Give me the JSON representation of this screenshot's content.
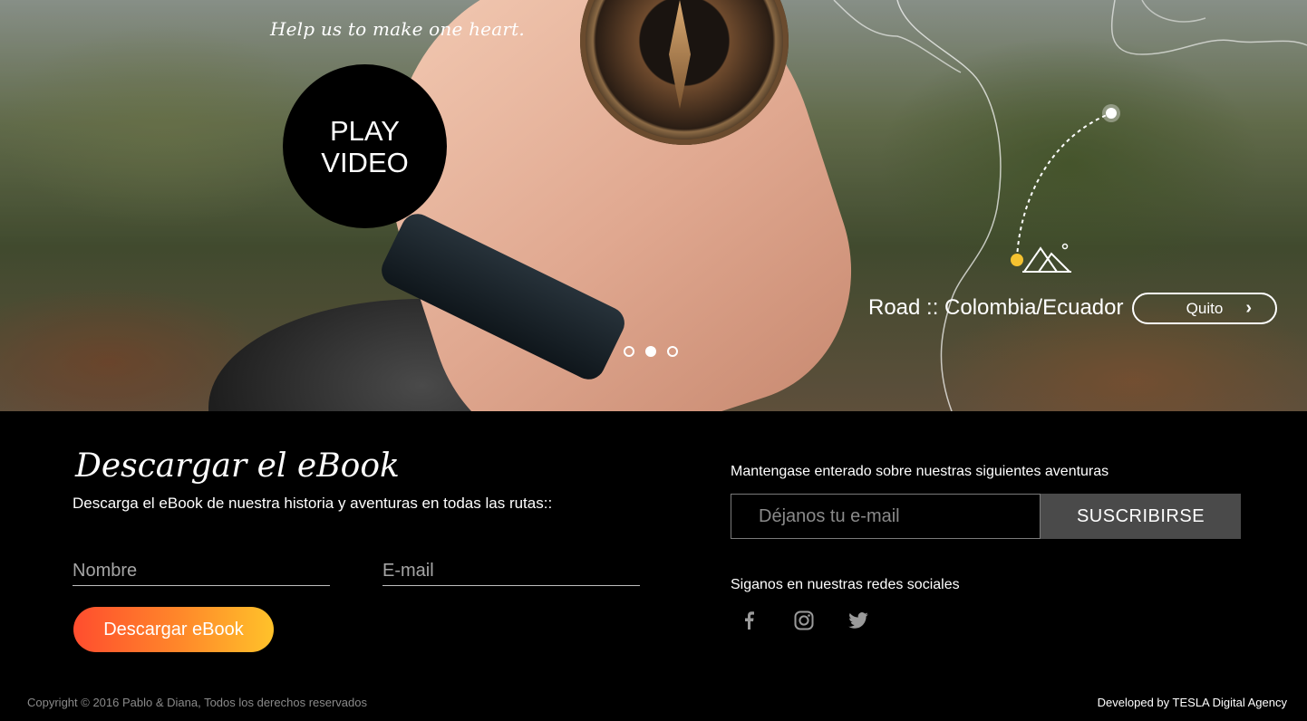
{
  "hero": {
    "tagline": "Help us to make one heart.",
    "play_label": "PLAY\nVIDEO",
    "route_label": "Road :: Colombia/Ecuador",
    "route_button": "Quito",
    "slides": {
      "count": 3,
      "active": 2
    }
  },
  "ebook": {
    "title": "Descargar el eBook",
    "description": "Descarga el eBook de nuestra historia y aventuras en todas las rutas::",
    "name_placeholder": "Nombre",
    "email_placeholder": "E-mail",
    "button_label": "Descargar eBook"
  },
  "newsletter": {
    "title": "Mantengase enterado sobre nuestras siguientes aventuras",
    "input_placeholder": "Déjanos tu e-mail",
    "button_label": "SUSCRIBIRSE"
  },
  "social": {
    "title": "Siganos en nuestras redes sociales",
    "icons": [
      "facebook-icon",
      "instagram-icon",
      "twitter-icon"
    ]
  },
  "footer": {
    "copyright": "Copyright © 2016 Pablo & Diana, Todos los derechos reservados",
    "developed": "Developed by TESLA Digital Agency"
  },
  "colors": {
    "accent_start": "#ff4d2e",
    "accent_end": "#ffc22a",
    "route_dot": "#f5c230",
    "subscribe_bg": "#4a4a4a"
  }
}
